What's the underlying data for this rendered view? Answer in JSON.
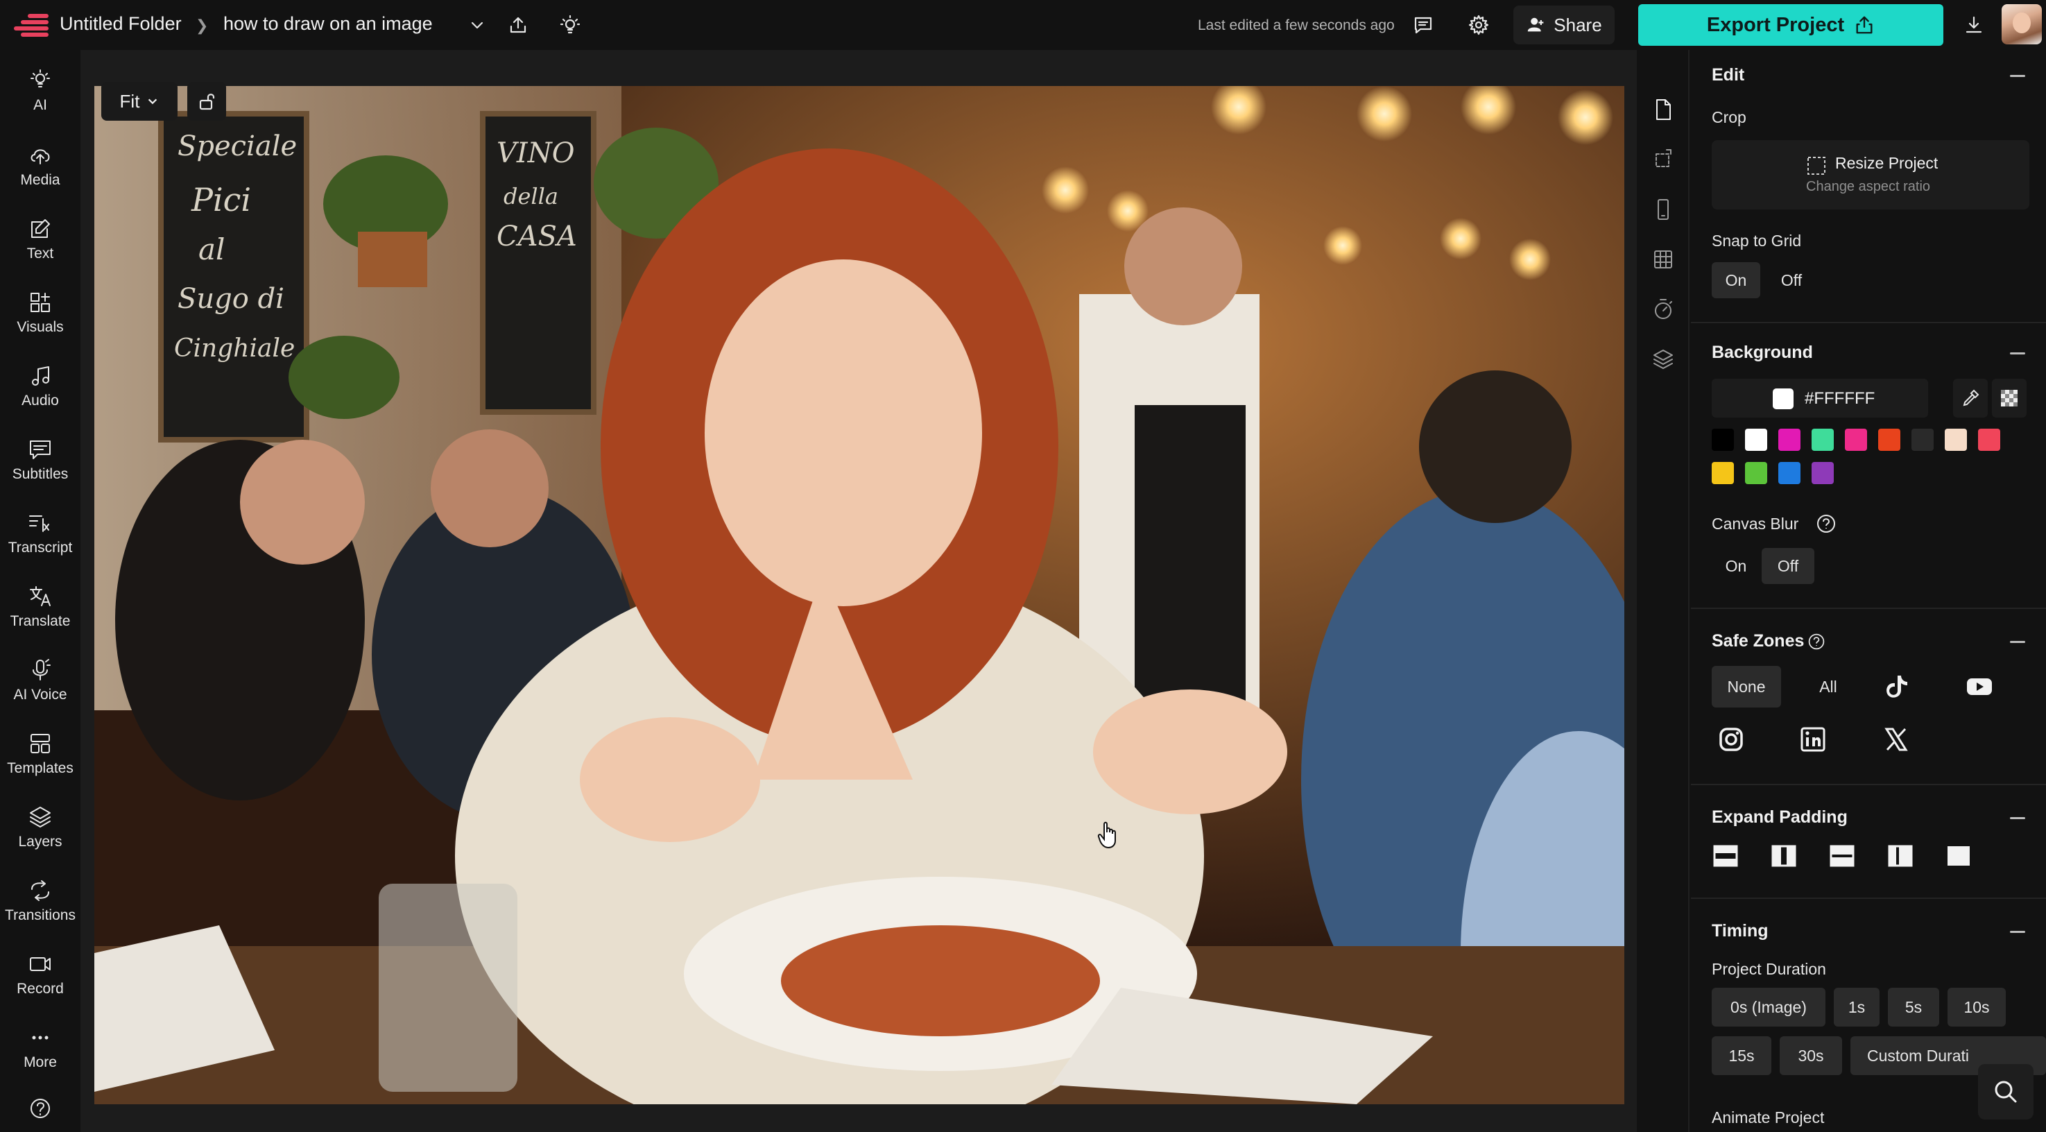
{
  "topbar": {
    "folder": "Untitled Folder",
    "project_name": "how to draw on an image",
    "last_edited": "Last edited a few seconds ago",
    "share_label": "Share",
    "export_label": "Export Project"
  },
  "sidebar": {
    "items": [
      {
        "label": "AI",
        "icon": "sparkle-bulb-icon"
      },
      {
        "label": "Media",
        "icon": "upload-cloud-icon"
      },
      {
        "label": "Text",
        "icon": "text-edit-icon"
      },
      {
        "label": "Visuals",
        "icon": "shapes-icon"
      },
      {
        "label": "Audio",
        "icon": "music-note-icon"
      },
      {
        "label": "Subtitles",
        "icon": "subtitles-icon"
      },
      {
        "label": "Transcript",
        "icon": "transcript-icon"
      },
      {
        "label": "Translate",
        "icon": "translate-icon"
      },
      {
        "label": "AI Voice",
        "icon": "microphone-icon"
      },
      {
        "label": "Templates",
        "icon": "templates-icon"
      },
      {
        "label": "Layers",
        "icon": "layers-icon"
      },
      {
        "label": "Transitions",
        "icon": "transitions-icon"
      },
      {
        "label": "Record",
        "icon": "camera-icon"
      },
      {
        "label": "More",
        "icon": "more-dots-icon"
      }
    ]
  },
  "canvas": {
    "fit_label": "Fit",
    "image_description_icon": "restaurant-photo"
  },
  "panel": {
    "edit": {
      "title": "Edit",
      "crop_label": "Crop",
      "resize_title": "Resize Project",
      "resize_subtitle": "Change aspect ratio",
      "snap_label": "Snap to Grid",
      "snap_on": "On",
      "snap_off": "Off",
      "snap_selected": "On"
    },
    "background": {
      "title": "Background",
      "color_value": "#FFFFFF",
      "swatches": [
        "#000000",
        "#ffffff",
        "#e21ab4",
        "#3fdc9a",
        "#ee2b8a",
        "#e8431c",
        "#2a2a2a",
        "#f6dcc8",
        "#f0455a",
        "#f5c518",
        "#5cc43a",
        "#1e7be0",
        "#8e3ab8"
      ],
      "blur_label": "Canvas Blur",
      "blur_on": "On",
      "blur_off": "Off",
      "blur_selected": "Off"
    },
    "safe_zones": {
      "title": "Safe Zones",
      "none_label": "None",
      "all_label": "All",
      "selected": "None",
      "platforms": [
        "tiktok",
        "youtube",
        "instagram",
        "linkedin",
        "x"
      ]
    },
    "expand_padding": {
      "title": "Expand Padding"
    },
    "timing": {
      "title": "Timing",
      "duration_label": "Project Duration",
      "options": [
        "0s (Image)",
        "1s",
        "5s",
        "10s",
        "15s",
        "30s",
        "Custom Durati"
      ],
      "selected": "0s (Image)",
      "animate_label": "Animate Project"
    }
  }
}
